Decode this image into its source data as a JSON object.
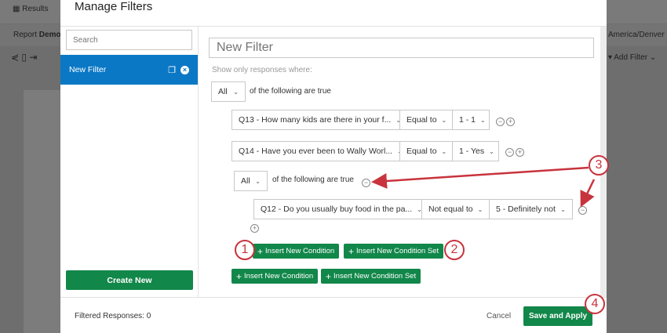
{
  "background": {
    "results_tab": "Results",
    "report_label": "Report",
    "report_name": "Demo",
    "timezone": "America/Denver",
    "add_filter": "Add Filter"
  },
  "modal": {
    "title": "Manage Filters",
    "sidebar": {
      "search_placeholder": "Search",
      "items": [
        {
          "label": "New Filter"
        }
      ],
      "create_new": "Create New"
    },
    "editor": {
      "filter_name_placeholder": "New Filter",
      "intro": "Show only responses where:",
      "top_group": {
        "quantifier": "All",
        "suffix": "of the following are true"
      },
      "conditions": [
        {
          "question": "Q13 - How many kids are there in your f...",
          "operator": "Equal to",
          "value": "1 - 1"
        },
        {
          "question": "Q14 - Have you ever been to Wally Worl...",
          "operator": "Equal to",
          "value": "1 - Yes"
        }
      ],
      "nested_group": {
        "quantifier": "All",
        "suffix": "of the following are true",
        "conditions": [
          {
            "question": "Q12 - Do you usually buy food in the pa...",
            "operator": "Not equal to",
            "value": "5 - Definitely not"
          }
        ]
      },
      "insert_condition": "Insert New Condition",
      "insert_condition_set": "Insert New Condition Set"
    },
    "footer": {
      "filtered_label": "Filtered Responses: 0",
      "cancel": "Cancel",
      "save": "Save and Apply"
    }
  },
  "annotations": [
    "1",
    "2",
    "3",
    "4"
  ],
  "colors": {
    "accent": "#0b78c5",
    "green": "#12874a",
    "annotation": "#c8333d"
  }
}
